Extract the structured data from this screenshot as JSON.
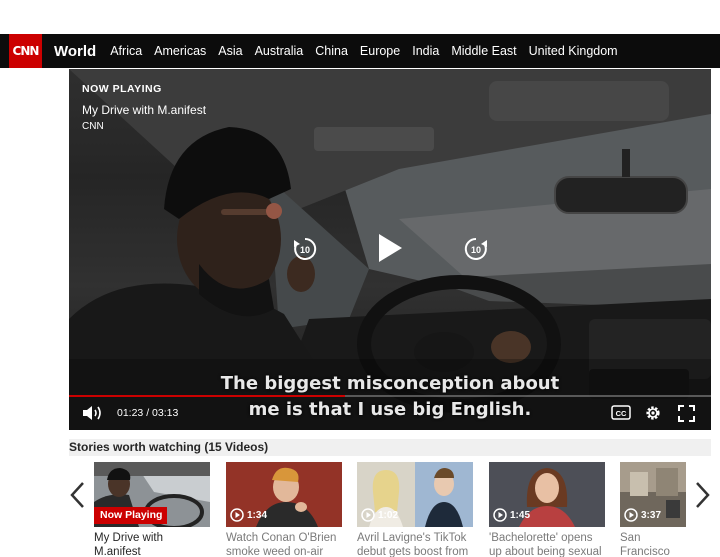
{
  "nav": {
    "logo": "CNN",
    "section": "World",
    "items": [
      "Africa",
      "Americas",
      "Asia",
      "Australia",
      "China",
      "Europe",
      "India",
      "Middle East",
      "United Kingdom"
    ]
  },
  "player": {
    "now_playing_label": "NOW PLAYING",
    "title": "My Drive with M.anifest",
    "source": "CNN",
    "subtitle_line1": "The biggest misconception about",
    "subtitle_line2": "me is that I use big English.",
    "current_time": "01:23",
    "total_time": "03:13",
    "time_separator": " / ",
    "progress": 0.43,
    "rewind_seconds": "10",
    "forward_seconds": "10",
    "cc_label": "CC"
  },
  "stories": {
    "header": "Stories worth watching (15 Videos)",
    "now_playing_badge": "Now Playing",
    "items": [
      {
        "title": "My Drive with M.anifest",
        "duration": "",
        "current": true
      },
      {
        "title": "Watch Conan O'Brien smoke weed on-air",
        "duration": "1:34",
        "current": false
      },
      {
        "title": "Avril Lavigne's TikTok debut gets boost from",
        "duration": "1:02",
        "current": false
      },
      {
        "title": "'Bachelorette' opens up about being sexual",
        "duration": "1:45",
        "current": false
      },
      {
        "title": "San Francisco surge fueled",
        "duration": "3:37",
        "current": false
      }
    ]
  },
  "colors": {
    "brand": "#cc0000",
    "nav_bg": "#0c0c0c"
  }
}
